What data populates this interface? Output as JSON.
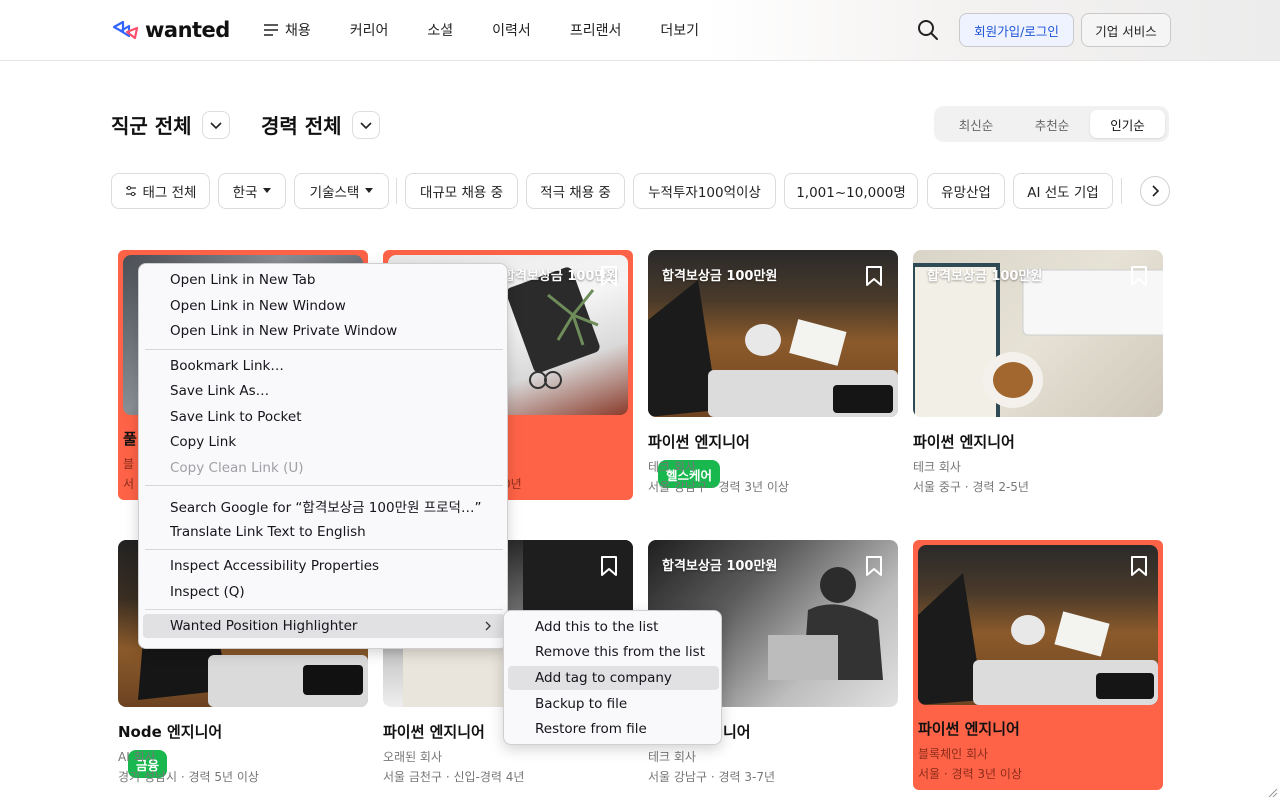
{
  "header": {
    "logo_text": "wanted",
    "nav": [
      "채용",
      "커리어",
      "소셜",
      "이력서",
      "프리랜서",
      "더보기"
    ],
    "signup_label": "회원가입/로그인",
    "business_label": "기업 서비스"
  },
  "filters": {
    "job_category": "직군 전체",
    "career": "경력 전체",
    "sort_options": [
      "최신순",
      "추천순",
      "인기순"
    ],
    "sort_selected": "인기순",
    "tags": [
      "태그 전체",
      "한국",
      "기술스택",
      "대규모 채용 중",
      "적극 채용 중",
      "누적투자100억이상",
      "1,001~10,000명",
      "유망산업",
      "AI 선도 기업"
    ]
  },
  "cards": [
    {
      "badge": "",
      "title": "풀",
      "company": "블",
      "meta": "서",
      "category": "",
      "highlighted": true
    },
    {
      "badge": "합격보상금 100만원",
      "title": "",
      "company": "",
      "meta": "0년",
      "category": "",
      "highlighted": true
    },
    {
      "badge": "합격보상금 100만원",
      "title": "파이썬 엔지니어",
      "company": "테크 회사",
      "meta": "서울 강남구 · 경력 3년 이상",
      "category": "헬스케어",
      "highlighted": false
    },
    {
      "badge": "합격보상금 100만원",
      "title": "파이썬 엔지니어",
      "company": "테크 회사",
      "meta": "서울 중구 · 경력 2-5년",
      "category": "",
      "highlighted": false
    },
    {
      "badge": "",
      "title": "Node 엔지니어",
      "company": "AI 회사",
      "meta": "경기 성남시 · 경력 5년 이상",
      "category": "금융",
      "highlighted": false
    },
    {
      "badge": "",
      "title": "파이썬 엔지니어",
      "company": "오래된 회사",
      "meta": "서울 금천구 · 신입-경력 4년",
      "category": "",
      "highlighted": false
    },
    {
      "badge": "합격보상금 100만원",
      "title": "니어",
      "company": "테크 회사",
      "meta": "서울 강남구 · 경력 3-7년",
      "category": "",
      "highlighted": false
    },
    {
      "badge": "",
      "title": "파이썬 엔지니어",
      "company": "블록체인 회사",
      "meta": "서울 · 경력 3년 이상",
      "category": "",
      "highlighted": true
    }
  ],
  "context_menu": {
    "items": [
      "Open Link in New Tab",
      "Open Link in New Window",
      "Open Link in New Private Window",
      "Bookmark Link…",
      "Save Link As…",
      "Save Link to Pocket",
      "Copy Link",
      "Copy Clean Link (U)",
      "Search Google for “합격보상금 100만원 프로덕…”",
      "Translate Link Text to English",
      "Inspect Accessibility Properties",
      "Inspect (Q)",
      "Wanted Position Highlighter"
    ],
    "submenu": [
      "Add this to the list",
      "Remove this from the list",
      "Add tag to company",
      "Backup to file",
      "Restore from file"
    ]
  },
  "colors": {
    "highlight": "#ff6347",
    "category_badge": "#19b84f",
    "login_text": "#1f54d6"
  }
}
